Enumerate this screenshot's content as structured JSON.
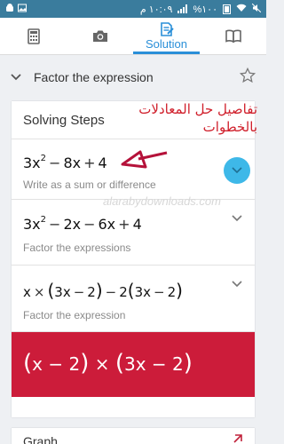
{
  "statusbar": {
    "time": "١٠:٠٩ م",
    "battery": "%١٠٠"
  },
  "tabs": [
    {
      "name": "calculator",
      "icon": "calculator-icon",
      "label": ""
    },
    {
      "name": "camera",
      "icon": "camera-icon",
      "label": ""
    },
    {
      "name": "solution",
      "icon": "solution-icon",
      "label": "Solution"
    },
    {
      "name": "book",
      "icon": "book-icon",
      "label": ""
    }
  ],
  "header": {
    "title": "Factor the expression",
    "star_icon": "star-outline-icon"
  },
  "card": {
    "title": "Solving Steps"
  },
  "annotation": {
    "arabic": "تفاصيل حل المعادلات بالخطوات",
    "watermark": "alarabydownloads.com"
  },
  "steps": [
    {
      "expression": "3x^2 − 8x + 4",
      "description": "Write as a sum or difference"
    },
    {
      "expression": "3x^2 − 2x − 6x + 4",
      "description": "Factor the expressions"
    },
    {
      "expression": "x×(3x − 2) − 2(3x − 2)",
      "description": "Factor the expression"
    }
  ],
  "result": {
    "expression": "(x − 2)×(3x − 2)"
  },
  "graph": {
    "label": "Graph"
  },
  "colors": {
    "statusbar": "#3a7c9d",
    "accent": "#2a8fd8",
    "result_bg": "#cc1c3a",
    "annotation": "#d0202c",
    "fab": "#3eb8e8"
  }
}
